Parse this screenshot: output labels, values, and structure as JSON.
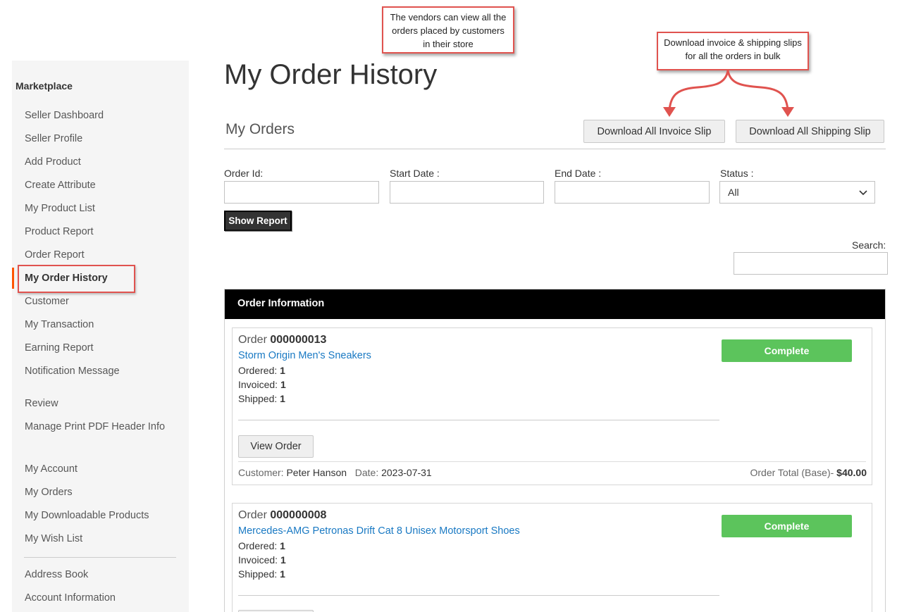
{
  "sidebar": {
    "heading": "Marketplace",
    "items": [
      {
        "label": "Seller Dashboard"
      },
      {
        "label": "Seller Profile"
      },
      {
        "label": "Add Product"
      },
      {
        "label": "Create Attribute"
      },
      {
        "label": "My Product List"
      },
      {
        "label": "Product Report"
      },
      {
        "label": "Order Report"
      },
      {
        "label": "My Order History"
      },
      {
        "label": "Customer"
      },
      {
        "label": "My Transaction"
      },
      {
        "label": "Earning Report"
      },
      {
        "label": "Notification Message"
      },
      {
        "label": "Review"
      },
      {
        "label": "Manage Print PDF Header Info"
      },
      {
        "label": "My Account"
      },
      {
        "label": "My Orders"
      },
      {
        "label": "My Downloadable Products"
      },
      {
        "label": "My Wish List"
      },
      {
        "label": "Address Book"
      },
      {
        "label": "Account Information"
      }
    ],
    "active_item": "My Order History"
  },
  "annotations": {
    "vendors_note": "The vendors can view all the orders placed by customers in their store",
    "download_note": "Download invoice & shipping slips for all the orders in bulk"
  },
  "page": {
    "title": "My Order History",
    "section_title": "My Orders"
  },
  "toolbar": {
    "invoice_label": "Download All Invoice Slip",
    "shipping_label": "Download All Shipping Slip"
  },
  "filters": {
    "order_id_label": "Order Id:",
    "start_date_label": "Start Date :",
    "end_date_label": "End Date :",
    "status_label": "Status :",
    "status_value": "All",
    "show_report_label": "Show Report",
    "search_label": "Search:"
  },
  "panel": {
    "header": "Order Information"
  },
  "orders": [
    {
      "order_word": "Order",
      "number": "000000013",
      "product": "Storm Origin Men's Sneakers",
      "ordered_label": "Ordered:",
      "ordered": "1",
      "invoiced_label": "Invoiced:",
      "invoiced": "1",
      "shipped_label": "Shipped:",
      "shipped": "1",
      "status": "Complete",
      "view_label": "View Order",
      "customer_label": "Customer:",
      "customer": "Peter Hanson",
      "date_label": "Date:",
      "date": "2023-07-31",
      "total_label": "Order Total (Base)-",
      "total": "$40.00"
    },
    {
      "order_word": "Order",
      "number": "000000008",
      "product": "Mercedes-AMG Petronas Drift Cat 8 Unisex Motorsport Shoes",
      "ordered_label": "Ordered:",
      "ordered": "1",
      "invoiced_label": "Invoiced:",
      "invoiced": "1",
      "shipped_label": "Shipped:",
      "shipped": "1",
      "status": "Complete"
    }
  ],
  "colors": {
    "accent_active": "#ff5501",
    "annotation_border": "#e0534f",
    "status_complete": "#5cc45c",
    "link": "#1979c3",
    "panel_header": "#000000"
  }
}
